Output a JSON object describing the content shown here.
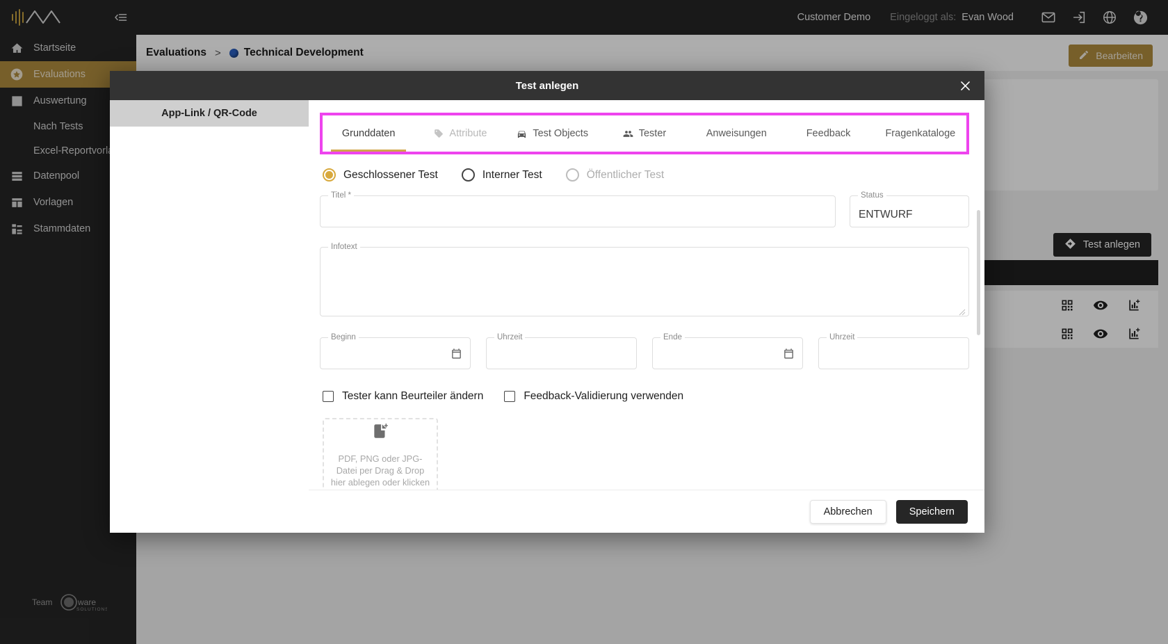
{
  "topbar": {
    "customer": "Customer Demo",
    "logged_in_label": "Eingeloggt als:",
    "user": "Evan Wood",
    "icons": [
      "mail-icon",
      "logout-icon",
      "globe-icon",
      "help-icon"
    ],
    "collapse_icon": "collapse-sidebar-icon",
    "logo": "ava-logo",
    "bg": "#262626"
  },
  "sidebar": {
    "items": [
      {
        "label": "Startseite",
        "icon": "home-icon",
        "active": false
      },
      {
        "label": "Evaluations",
        "icon": "star-icon",
        "active": true
      },
      {
        "label": "Auswertung",
        "icon": "chart-bar-icon",
        "active": false
      }
    ],
    "subitems": [
      {
        "label": "Nach Tests"
      },
      {
        "label": "Excel-Reportvorlagen"
      }
    ],
    "items_after": [
      {
        "label": "Datenpool",
        "icon": "database-icon",
        "active": false
      },
      {
        "label": "Vorlagen",
        "icon": "template-icon",
        "active": false
      },
      {
        "label": "Stammdaten",
        "icon": "master-data-icon",
        "active": false
      }
    ],
    "footer_logo": "teamware-solutions-logo",
    "footer_logo_text": "Team ware",
    "footer_logo_sub": "SOLUTIONS",
    "active_color": "#b08d3e"
  },
  "page": {
    "breadcrumb": {
      "root": "Evaluations",
      "separator": ">",
      "current": "Technical Development",
      "dot_color": "#2b61c4"
    },
    "edit_button": "Bearbeiten",
    "create_test_button": "Test anlegen",
    "row_icons": [
      "qr-code-icon",
      "eye-icon",
      "add-chart-icon"
    ]
  },
  "modal": {
    "title": "Test anlegen",
    "close_icon": "close-icon",
    "side_header": "App-Link / QR-Code",
    "highlight_color": "#ee44ee",
    "tabs": [
      {
        "label": "Grunddaten",
        "icon": null,
        "active": true,
        "disabled": false
      },
      {
        "label": "Attribute",
        "icon": "tag-icon",
        "active": false,
        "disabled": true
      },
      {
        "label": "Test Objects",
        "icon": "car-icon",
        "active": false,
        "disabled": false
      },
      {
        "label": "Tester",
        "icon": "people-icon",
        "active": false,
        "disabled": false
      },
      {
        "label": "Anweisungen",
        "icon": null,
        "active": false,
        "disabled": false
      },
      {
        "label": "Feedback",
        "icon": null,
        "active": false,
        "disabled": false
      },
      {
        "label": "Fragenkataloge",
        "icon": null,
        "active": false,
        "disabled": false
      }
    ],
    "test_type": {
      "options": [
        {
          "label": "Geschlossener Test",
          "selected": true,
          "disabled": false
        },
        {
          "label": "Interner Test",
          "selected": false,
          "disabled": false
        },
        {
          "label": "Öffentlicher Test",
          "selected": false,
          "disabled": true
        }
      ]
    },
    "fields": {
      "titel": {
        "label": "Titel *",
        "value": ""
      },
      "status": {
        "label": "Status",
        "value": "ENTWURF"
      },
      "infotext": {
        "label": "Infotext",
        "value": ""
      },
      "beginn": {
        "label": "Beginn",
        "value": "",
        "icon": "calendar-icon"
      },
      "beginn_uhrzeit": {
        "label": "Uhrzeit",
        "value": ""
      },
      "ende": {
        "label": "Ende",
        "value": "",
        "icon": "calendar-icon"
      },
      "ende_uhrzeit": {
        "label": "Uhrzeit",
        "value": ""
      }
    },
    "checkboxes": [
      {
        "label": "Tester kann Beurteiler ändern",
        "checked": false
      },
      {
        "label": "Feedback-Validierung verwenden",
        "checked": false
      }
    ],
    "dropzone": {
      "icon": "note-add-icon",
      "text": "PDF, PNG oder JPG-Datei per Drag & Drop hier ablegen oder klicken um eine Datei auszuwählen"
    },
    "footer": {
      "cancel": "Abbrechen",
      "save": "Speichern"
    }
  }
}
